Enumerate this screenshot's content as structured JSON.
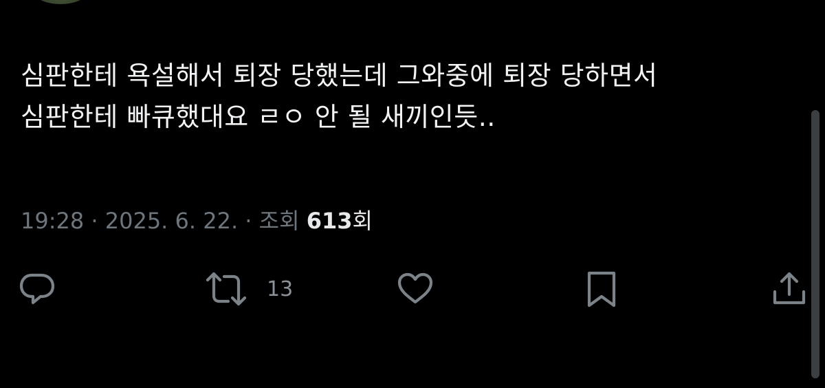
{
  "tweet": {
    "text_line1": "심판한테 욕설해서 퇴장 당했는데 그와중에 퇴장 당하면서",
    "text_line2": "심판한테 빠큐했대요 ㄹㅇ 안 될 새끼인듯.."
  },
  "meta": {
    "time": "19:28",
    "separator1": " · ",
    "date": "2025. 6. 22.",
    "separator2": " · ",
    "views_label": "조회 ",
    "views_count": "613",
    "views_unit": "회"
  },
  "actions": {
    "reply_icon": "reply-icon",
    "retweet_icon": "retweet-icon",
    "retweet_count": "13",
    "like_icon": "heart-icon",
    "bookmark_icon": "bookmark-icon",
    "share_icon": "share-icon"
  },
  "colors": {
    "background": "#000000",
    "text": "#f2f3f4",
    "muted": "#6e767d",
    "icon": "#7b8288"
  }
}
